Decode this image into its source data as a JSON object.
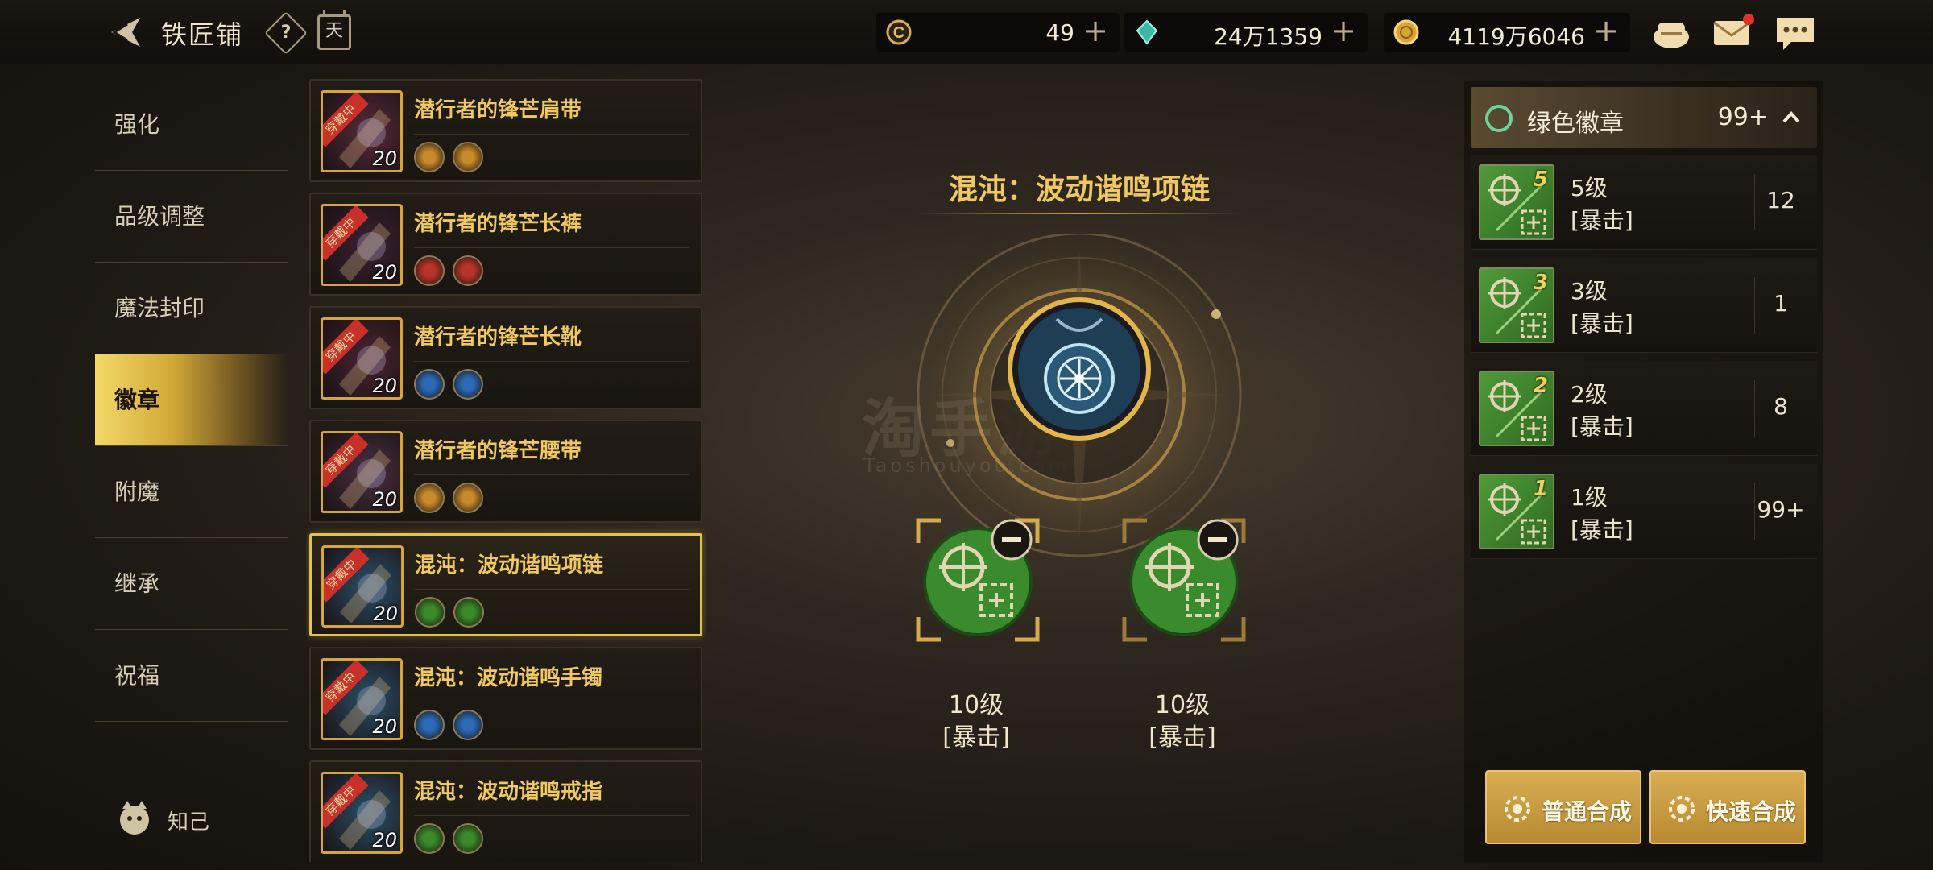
{
  "header": {
    "title": "铁匠铺",
    "help_label": "?",
    "calendar_label": "天",
    "currencies": [
      {
        "icon": "c-coin-icon",
        "value": "49"
      },
      {
        "icon": "crystal-icon",
        "value": "24万1359"
      },
      {
        "icon": "gold-coin-icon",
        "value": "4119万6046"
      }
    ],
    "icons": [
      "pouch-icon",
      "mail-icon",
      "chat-icon"
    ]
  },
  "tabs": [
    {
      "label": "强化"
    },
    {
      "label": "品级调整"
    },
    {
      "label": "魔法封印"
    },
    {
      "label": "徽章",
      "active": true
    },
    {
      "label": "附魔"
    },
    {
      "label": "继承"
    },
    {
      "label": "祝福"
    }
  ],
  "footer_left": {
    "label": "知己"
  },
  "items": [
    {
      "name": "潜行者的锋芒肩带",
      "level": "20",
      "ribbon": "穿戴中",
      "slot_color": "#c98a2a"
    },
    {
      "name": "潜行者的锋芒长裤",
      "level": "20",
      "ribbon": "穿戴中",
      "slot_color": "#b8342a"
    },
    {
      "name": "潜行者的锋芒长靴",
      "level": "20",
      "ribbon": "穿戴中",
      "slot_color": "#2a6ab8"
    },
    {
      "name": "潜行者的锋芒腰带",
      "level": "20",
      "ribbon": "穿戴中",
      "slot_color": "#c98a2a"
    },
    {
      "name": "混沌：波动谐鸣项链",
      "level": "20",
      "ribbon": "穿戴中",
      "slot_color": "#3a8a2a",
      "selected": true
    },
    {
      "name": "混沌：波动谐鸣手镯",
      "level": "20",
      "ribbon": "穿戴中",
      "slot_color": "#2a6ab8"
    },
    {
      "name": "混沌：波动谐鸣戒指",
      "level": "20",
      "ribbon": "穿戴中",
      "slot_color": "#3a8a2a"
    }
  ],
  "center": {
    "title": "混沌：波动谐鸣项链",
    "materials": [
      {
        "level": "10级",
        "type": "[暴击]"
      },
      {
        "level": "10级",
        "type": "[暴击]"
      }
    ]
  },
  "watermark": {
    "cn": "淘手游",
    "en": "Taoshouyou.com"
  },
  "badge_panel": {
    "header_label": "绿色徽章",
    "header_count": "99+",
    "accent": "#6fd29a",
    "rows": [
      {
        "grade": "5",
        "level": "5级",
        "type": "[暴击]",
        "count": "12"
      },
      {
        "grade": "3",
        "level": "3级",
        "type": "[暴击]",
        "count": "1"
      },
      {
        "grade": "2",
        "level": "2级",
        "type": "[暴击]",
        "count": "8"
      },
      {
        "grade": "1",
        "level": "1级",
        "type": "[暴击]",
        "count": "99+"
      }
    ]
  },
  "buttons": {
    "normal_craft": "普通合成",
    "quick_craft": "快速合成"
  }
}
